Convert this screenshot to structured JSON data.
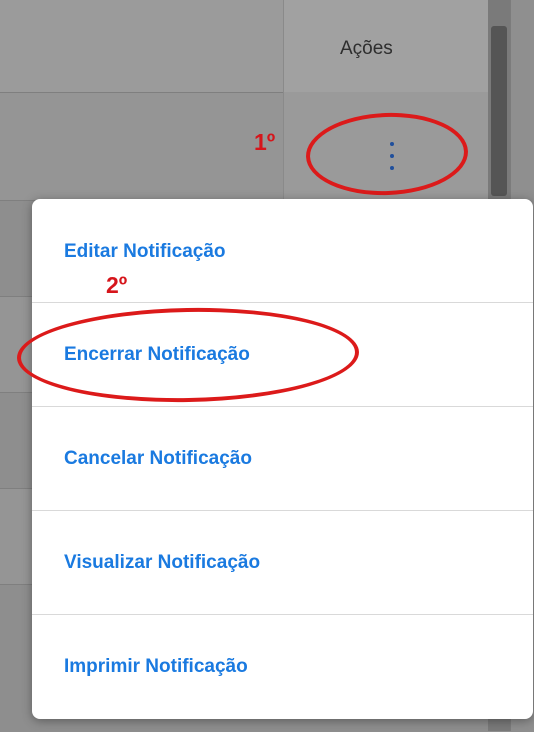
{
  "table": {
    "actions_header": "Ações"
  },
  "annotations": {
    "step1": "1º",
    "step2": "2º"
  },
  "menu": {
    "items": [
      {
        "label": "Editar Notificação"
      },
      {
        "label": "Encerrar Notificação"
      },
      {
        "label": "Cancelar Notificação"
      },
      {
        "label": "Visualizar Notificação"
      },
      {
        "label": "Imprimir Notificação"
      }
    ]
  },
  "colors": {
    "menu_text": "#1a7ae0",
    "annotation_red": "#d6151b",
    "overlay": "#8f8f8f"
  }
}
